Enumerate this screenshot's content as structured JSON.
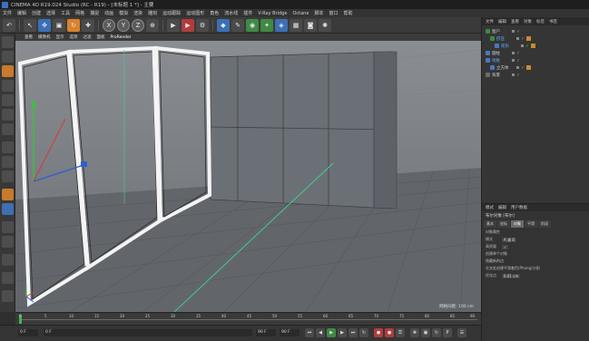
{
  "window": {
    "title": "CINEMA 4D R19.024 Studio (RC - R19) - [未标题 1 *] - 主要"
  },
  "menubar": {
    "items": [
      "文件",
      "编辑",
      "创建",
      "选择",
      "工具",
      "网格",
      "捕捉",
      "动画",
      "模拟",
      "渲染",
      "雕刻",
      "运动跟踪",
      "运动图形",
      "角色",
      "流水线",
      "插件",
      "V-Ray Bridge",
      "Octane",
      "脚本",
      "窗口",
      "帮助"
    ]
  },
  "viewport": {
    "menu": [
      "查看",
      "摄像机",
      "显示",
      "选项",
      "过滤",
      "面板",
      "ProRender"
    ],
    "grid_info": "网格间距: 100 cm"
  },
  "object_manager": {
    "tabs": [
      "文件",
      "编辑",
      "查看",
      "对象",
      "标签",
      "书签"
    ],
    "rows": [
      {
        "label": "窗户",
        "color": "#e0e0e0"
      },
      {
        "label": "挤压",
        "color": "#66a9ff"
      },
      {
        "label": "矩形",
        "color": "#66a9ff"
      },
      {
        "label": "圆柱",
        "color": "#e0e0e0"
      },
      {
        "label": "地板",
        "color": "#66a9ff"
      },
      {
        "label": "立方体",
        "color": "#e0e0e0"
      },
      {
        "label": "背景",
        "color": "#e0e0e0"
      }
    ]
  },
  "attributes": {
    "tabs": [
      "模式",
      "编辑",
      "用户数据"
    ],
    "title": "布尔对象 [布尔]",
    "subtabs": [
      "基本",
      "坐标",
      "对象",
      "平滑",
      "阶段"
    ],
    "section": "对象属性",
    "fields": [
      {
        "label": "模式",
        "value": "A 减 B"
      },
      {
        "label": "高质量",
        "value": "✓"
      },
      {
        "label": "创建单个对象",
        "value": ""
      },
      {
        "label": "隐藏新的边",
        "value": ""
      },
      {
        "label": "交叉处创建平滑着色(Phong)分割",
        "value": ""
      },
      {
        "label": "优化点",
        "value": "0.01 cm"
      }
    ]
  },
  "timeline": {
    "ticks": [
      "0",
      "5",
      "10",
      "15",
      "20",
      "25",
      "30",
      "35",
      "40",
      "45",
      "50",
      "55",
      "60",
      "65",
      "70",
      "75",
      "80",
      "85",
      "90"
    ],
    "playhead": 0
  },
  "transport": {
    "start_frame": "0 F",
    "current_frame": "0 F",
    "end_frame": "90 F",
    "end_frame_2": "90 F"
  },
  "icons": {
    "accent": "#3b6fb6",
    "active_green": "#49b34b",
    "record_red": "#b33b3b"
  }
}
